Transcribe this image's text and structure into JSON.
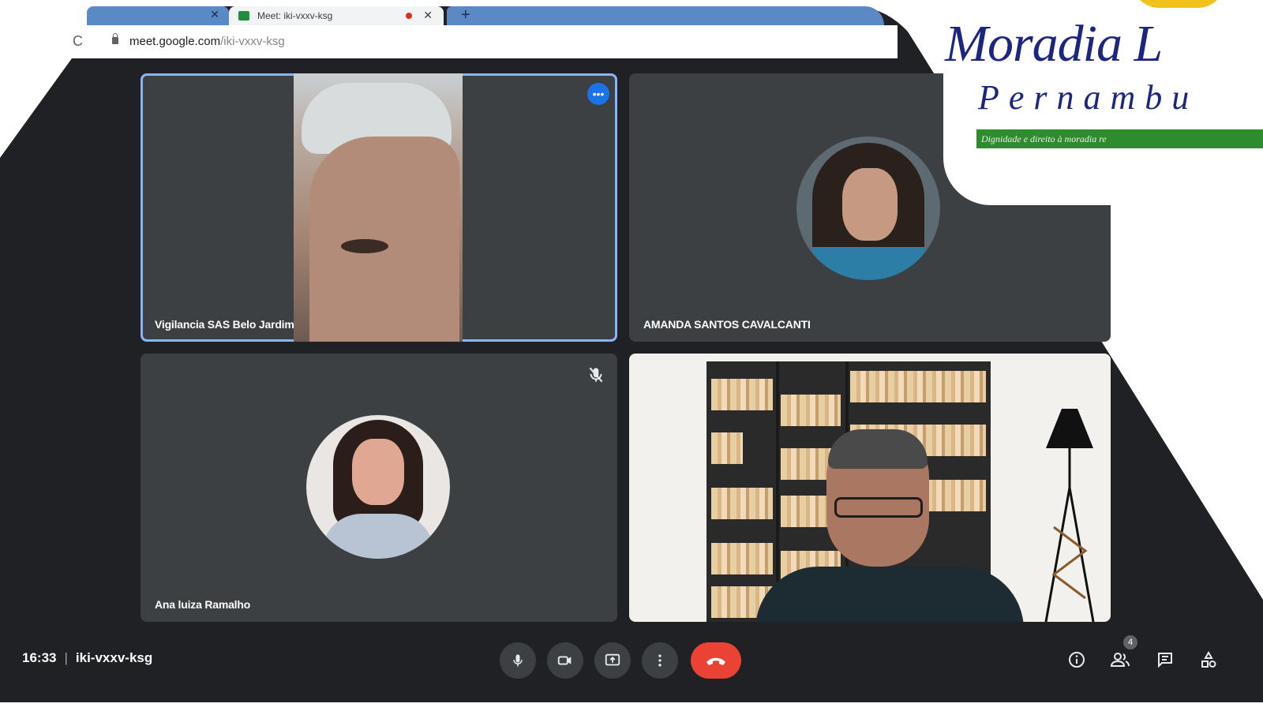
{
  "browser": {
    "active_tab_title": "Meet: iki-vxxv-ksg",
    "url_host": "meet.google.com",
    "url_path": "/iki-vxxv-ksg"
  },
  "tiles": [
    {
      "name": "Vigilancia SAS Belo Jardim"
    },
    {
      "name": "AMANDA SANTOS CAVALCANTI"
    },
    {
      "name": "Ana luiza Ramalho"
    },
    {
      "name": ""
    }
  ],
  "meeting": {
    "time": "16:33",
    "code": "iki-vxxv-ksg",
    "participants_count": "4"
  },
  "colors": {
    "background": "#202124",
    "tile": "#3c4043",
    "accent": "#8ab4f8",
    "end_call": "#ea4335",
    "logo_blue": "#1c2680",
    "logo_green": "#2e8b2e"
  },
  "logo": {
    "title": "Moradia L",
    "subtitle": "Pernambu",
    "tagline": "Dignidade e direito à moradia re"
  },
  "icons": [
    "reload-icon",
    "lock-icon",
    "more-options-icon",
    "mic-off-icon",
    "mic-icon",
    "camera-icon",
    "present-icon",
    "more-vert-icon",
    "end-call-icon",
    "info-icon",
    "people-icon",
    "chat-icon",
    "activities-icon"
  ]
}
